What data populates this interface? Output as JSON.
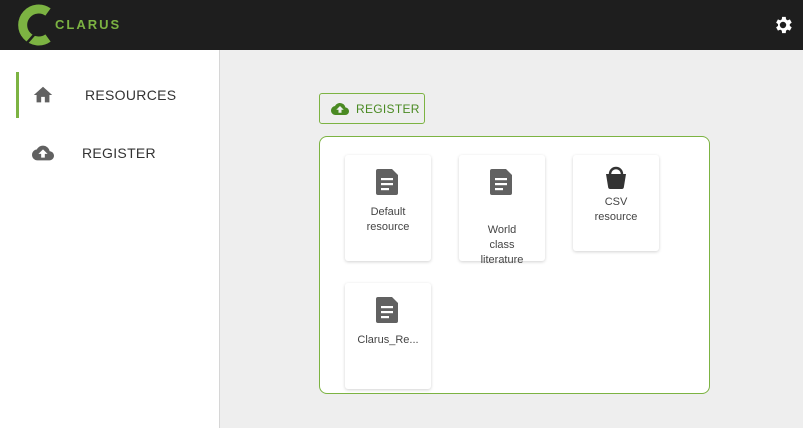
{
  "header": {
    "logo_text": "CLARUS",
    "brand_color": "#7cb342",
    "settings_icon": "gear-icon"
  },
  "sidebar": {
    "items": [
      {
        "label": "RESOURCES",
        "icon": "home-icon",
        "active": true
      },
      {
        "label": "REGISTER",
        "icon": "cloud-upload-icon",
        "active": false
      }
    ]
  },
  "main": {
    "register_button": {
      "label": "REGISTER",
      "icon": "cloud-upload-icon"
    },
    "resources": [
      {
        "label": "Default\nresource",
        "icon": "document-icon"
      },
      {
        "label": "World\nclass\nliterature",
        "icon": "document-icon"
      },
      {
        "label": "CSV\nresource",
        "icon": "basket-icon"
      },
      {
        "label": "Clarus_Re...",
        "icon": "document-icon"
      }
    ]
  }
}
